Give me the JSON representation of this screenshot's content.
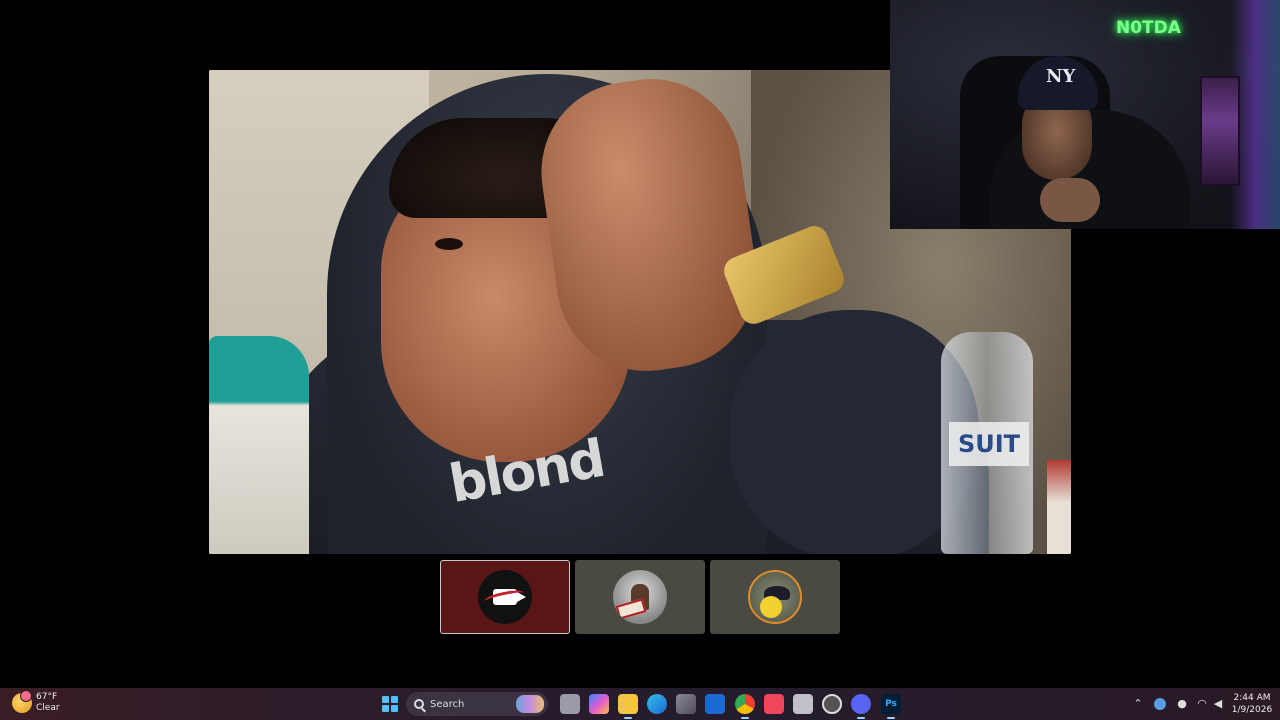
{
  "call": {
    "main_participant": {
      "shirt_text": "blond",
      "bottle_label": "SUIT"
    },
    "pip_participant": {
      "neon_sign": "N0TDA",
      "cap_logo": "NY"
    },
    "tiles": [
      {
        "name": "tile-1",
        "active": true
      },
      {
        "name": "tile-2",
        "active": false
      },
      {
        "name": "tile-3",
        "active": false
      }
    ]
  },
  "taskbar": {
    "weather": {
      "temp": "67°F",
      "condition": "Clear"
    },
    "search_label": "Search",
    "apps": [
      "task-view",
      "copilot",
      "file-explorer",
      "edge",
      "store",
      "outlook",
      "chrome",
      "music",
      "settings-app",
      "clock-app",
      "discord",
      "photoshop"
    ],
    "badges": {
      "discord": "1"
    },
    "tray": {
      "chevron": "^",
      "wifi": "wifi",
      "volume": "volume"
    },
    "time": "2:44 AM",
    "date": "1/9/2026"
  },
  "colors": {
    "active_tile": "#5a1616",
    "inactive_tile": "#4a4a42",
    "neon": "#7dff8a",
    "accent": "#4cc2ff"
  }
}
